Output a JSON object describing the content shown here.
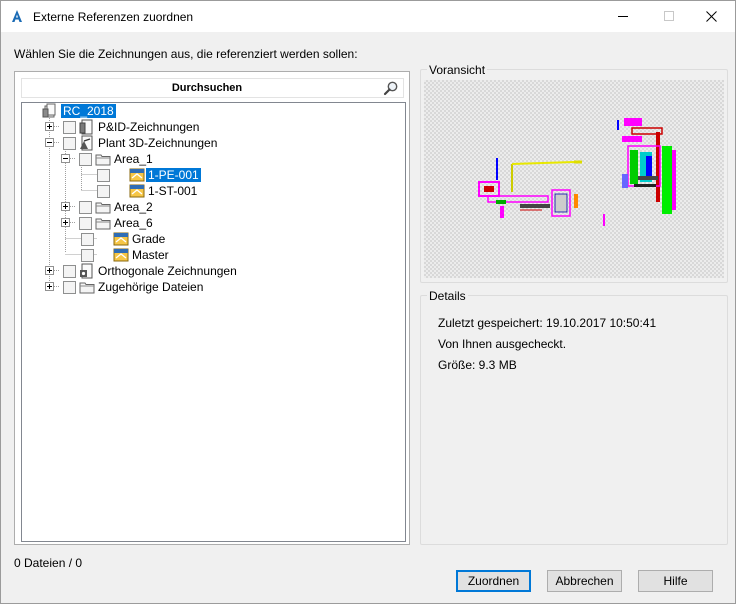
{
  "window": {
    "title": "Externe Referenzen zuordnen",
    "icon": "autocad-a-icon"
  },
  "instruction": "Wählen Sie die Zeichnungen aus, die referenziert werden sollen:",
  "browse": {
    "label": "Durchsuchen",
    "icon": "magnifier-icon"
  },
  "tree": {
    "root": {
      "label": "RC_2018",
      "selected": true
    },
    "nodes": [
      {
        "label": "P&ID-Zeichnungen",
        "expander": "plus",
        "checkbox": true,
        "icon": "pid-drawings-icon"
      },
      {
        "label": "Plant 3D-Zeichnungen",
        "expander": "minus",
        "checkbox": true,
        "icon": "plant3d-drawings-icon"
      },
      {
        "label": "Area_1",
        "expander": "minus",
        "checkbox": true,
        "icon": "folder-icon"
      },
      {
        "label": "1-PE-001",
        "checkbox": true,
        "icon": "dwg-file-icon",
        "selected": true
      },
      {
        "label": "1-ST-001",
        "checkbox": true,
        "icon": "dwg-file-icon"
      },
      {
        "label": "Area_2",
        "expander": "plus",
        "checkbox": true,
        "icon": "folder-icon"
      },
      {
        "label": "Area_6",
        "expander": "plus",
        "checkbox": true,
        "icon": "folder-icon"
      },
      {
        "label": "Grade",
        "checkbox": true,
        "icon": "dwg-file-icon"
      },
      {
        "label": "Master",
        "checkbox": true,
        "icon": "dwg-file-icon"
      },
      {
        "label": "Orthogonale Zeichnungen",
        "expander": "plus",
        "checkbox": true,
        "icon": "ortho-drawings-icon"
      },
      {
        "label": "Zugehörige Dateien",
        "expander": "plus",
        "checkbox": true,
        "icon": "folder-icon"
      }
    ]
  },
  "preview": {
    "title": "Voransicht"
  },
  "details": {
    "title": "Details",
    "saved": "Zuletzt gespeichert: 19.10.2017 10:50:41",
    "checked_out": "Von Ihnen ausgecheckt.",
    "size": "Größe:  9.3 MB"
  },
  "status": "0 Dateien / 0",
  "buttons": {
    "ok": "Zuordnen",
    "cancel": "Abbrechen",
    "help": "Hilfe"
  },
  "colors": {
    "selection": "#0078d7",
    "dialog_bg": "#f0f0f0"
  }
}
